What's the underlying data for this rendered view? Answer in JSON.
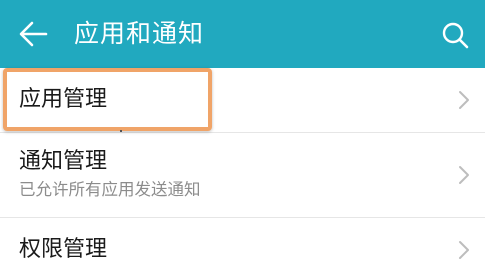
{
  "header": {
    "title": "应用和通知",
    "back_icon": "arrow-left-icon",
    "search_icon": "search-icon",
    "background_color": "#21a9bf"
  },
  "list": {
    "items": [
      {
        "label": "应用管理",
        "subtitle": ""
      },
      {
        "label": "通知管理",
        "subtitle": "已允许所有应用发送通知"
      },
      {
        "label": "权限管理",
        "subtitle": ""
      }
    ],
    "chevron_icon": "chevron-right-icon"
  },
  "highlight": {
    "color": "#f0a468",
    "target": "应用管理"
  }
}
